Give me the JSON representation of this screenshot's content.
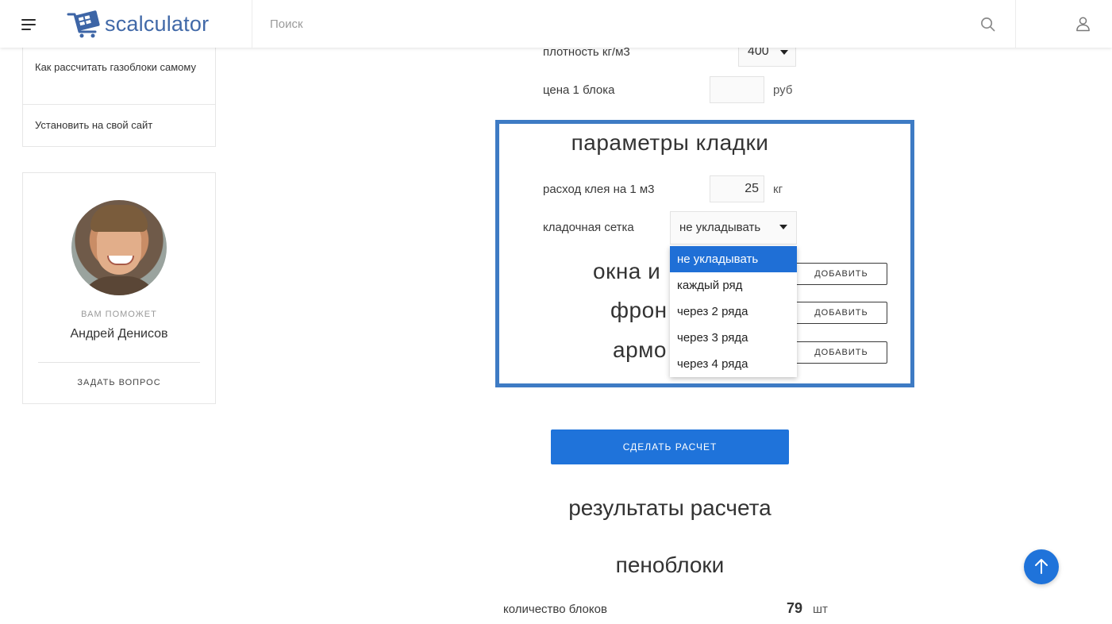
{
  "header": {
    "logo_text": "scalculator",
    "search_placeholder": "Поиск"
  },
  "sidebar": {
    "links": [
      "Как рассчитать газоблоки самому",
      "Установить на свой сайт"
    ],
    "helper": {
      "label": "ВАМ ПОМОЖЕТ",
      "name": "Андрей Денисов",
      "ask_button": "ЗАДАТЬ ВОПРОС"
    }
  },
  "form": {
    "density": {
      "label": "плотность кг/м3",
      "value": "400"
    },
    "block_price": {
      "label": "цена 1 блока",
      "value": "",
      "unit": "руб"
    }
  },
  "masonry": {
    "title": "параметры кладки",
    "glue": {
      "label": "расход клея на 1 м3",
      "value": "25",
      "unit": "кг"
    },
    "mesh": {
      "label": "кладочная сетка",
      "selected": "не укладывать",
      "options": [
        "не укладывать",
        "каждый ряд",
        "через 2 ряда",
        "через 3 ряда",
        "через 4 ряда"
      ]
    },
    "sections": [
      {
        "title": "окна и",
        "button": "ДОБАВИТЬ"
      },
      {
        "title": "фрон",
        "button": "ДОБАВИТЬ"
      },
      {
        "title": "армо",
        "button": "ДОБАВИТЬ"
      }
    ]
  },
  "calculate_button": "СДЕЛАТЬ РАСЧЕТ",
  "results": {
    "title": "результаты расчета",
    "subtitle": "пеноблоки",
    "blocks": {
      "label": "количество блоков",
      "value": "79",
      "unit": "шт"
    }
  },
  "colors": {
    "accent": "#1f73da",
    "panel_border": "#3e7bc4",
    "logo": "#4169a8"
  },
  "icons": {
    "menu": "hamburger-icon",
    "search": "search-icon",
    "user": "user-icon",
    "scroll_top": "arrow-up-icon"
  }
}
